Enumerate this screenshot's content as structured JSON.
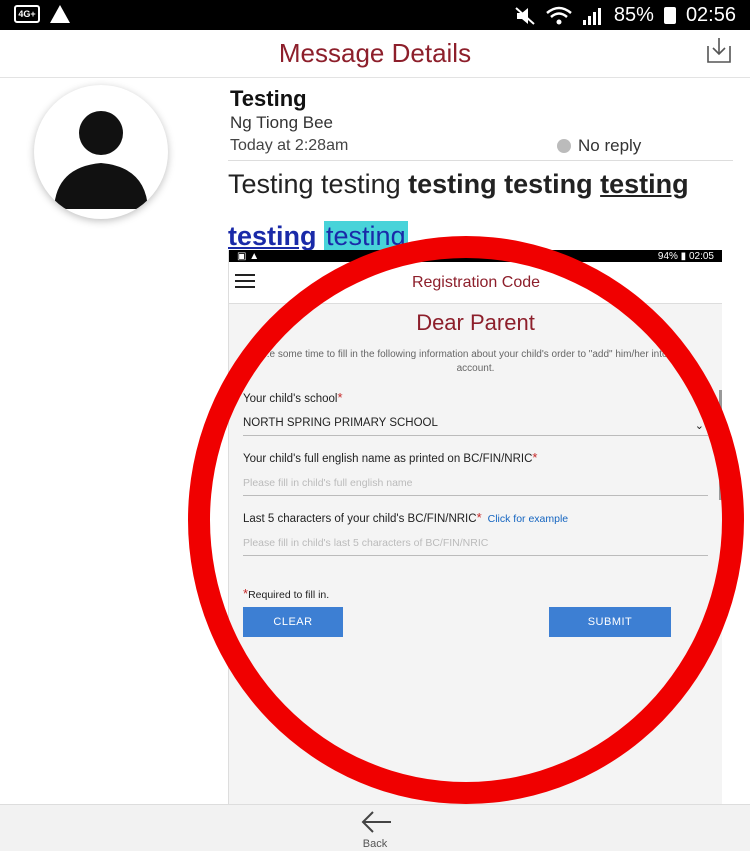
{
  "status_bar": {
    "sim_label": "4G+",
    "icons_left": [
      "sim-icon",
      "warning-icon"
    ],
    "icons_right": [
      "mute-icon",
      "wifi-icon",
      "signal-icon",
      "battery-icon"
    ],
    "battery": "85%",
    "time": "02:56"
  },
  "header": {
    "title": "Message Details",
    "action_icon": "download-icon"
  },
  "message": {
    "subject": "Testing",
    "sender": "Ng Tiong Bee",
    "time": "Today at 2:28am",
    "reply_status": "No reply",
    "body_plain": "Testing testing ",
    "body_bold": "testing testing ",
    "body_underline": "testing",
    "body_line2_bold": "testing",
    "body_line2_highlight": "testing"
  },
  "embedded_screen": {
    "status_battery": "94%",
    "status_time": "02:05",
    "header_title": "Registration Code",
    "heading": "Dear Parent",
    "intro": "...e some time to fill in the following information about your child's order to \"add\" him/her into your account.",
    "school_label": "Your child's school",
    "school_value": "NORTH SPRING PRIMARY SCHOOL",
    "name_label": "Your child's full english name as printed on BC/FIN/NRIC",
    "name_placeholder": "Please fill in child's full english name",
    "id_label": "Last 5 characters of your child's BC/FIN/NRIC",
    "id_example_link": "Click for example",
    "id_placeholder": "Please fill in child's last 5 characters of BC/FIN/NRIC",
    "required_note": "Required to fill in.",
    "required_mark": "*",
    "clear_button": "CLEAR",
    "submit_button": "SUBMIT"
  },
  "annotation": {
    "color": "#f00000",
    "shape": "circle"
  },
  "bottom_bar": {
    "back_label": "Back",
    "back_icon": "back-arrow-icon"
  },
  "colors": {
    "title": "#8d1f2b",
    "button": "#3d7fd3",
    "link": "#1565c0",
    "highlight": "#48d3d9"
  }
}
